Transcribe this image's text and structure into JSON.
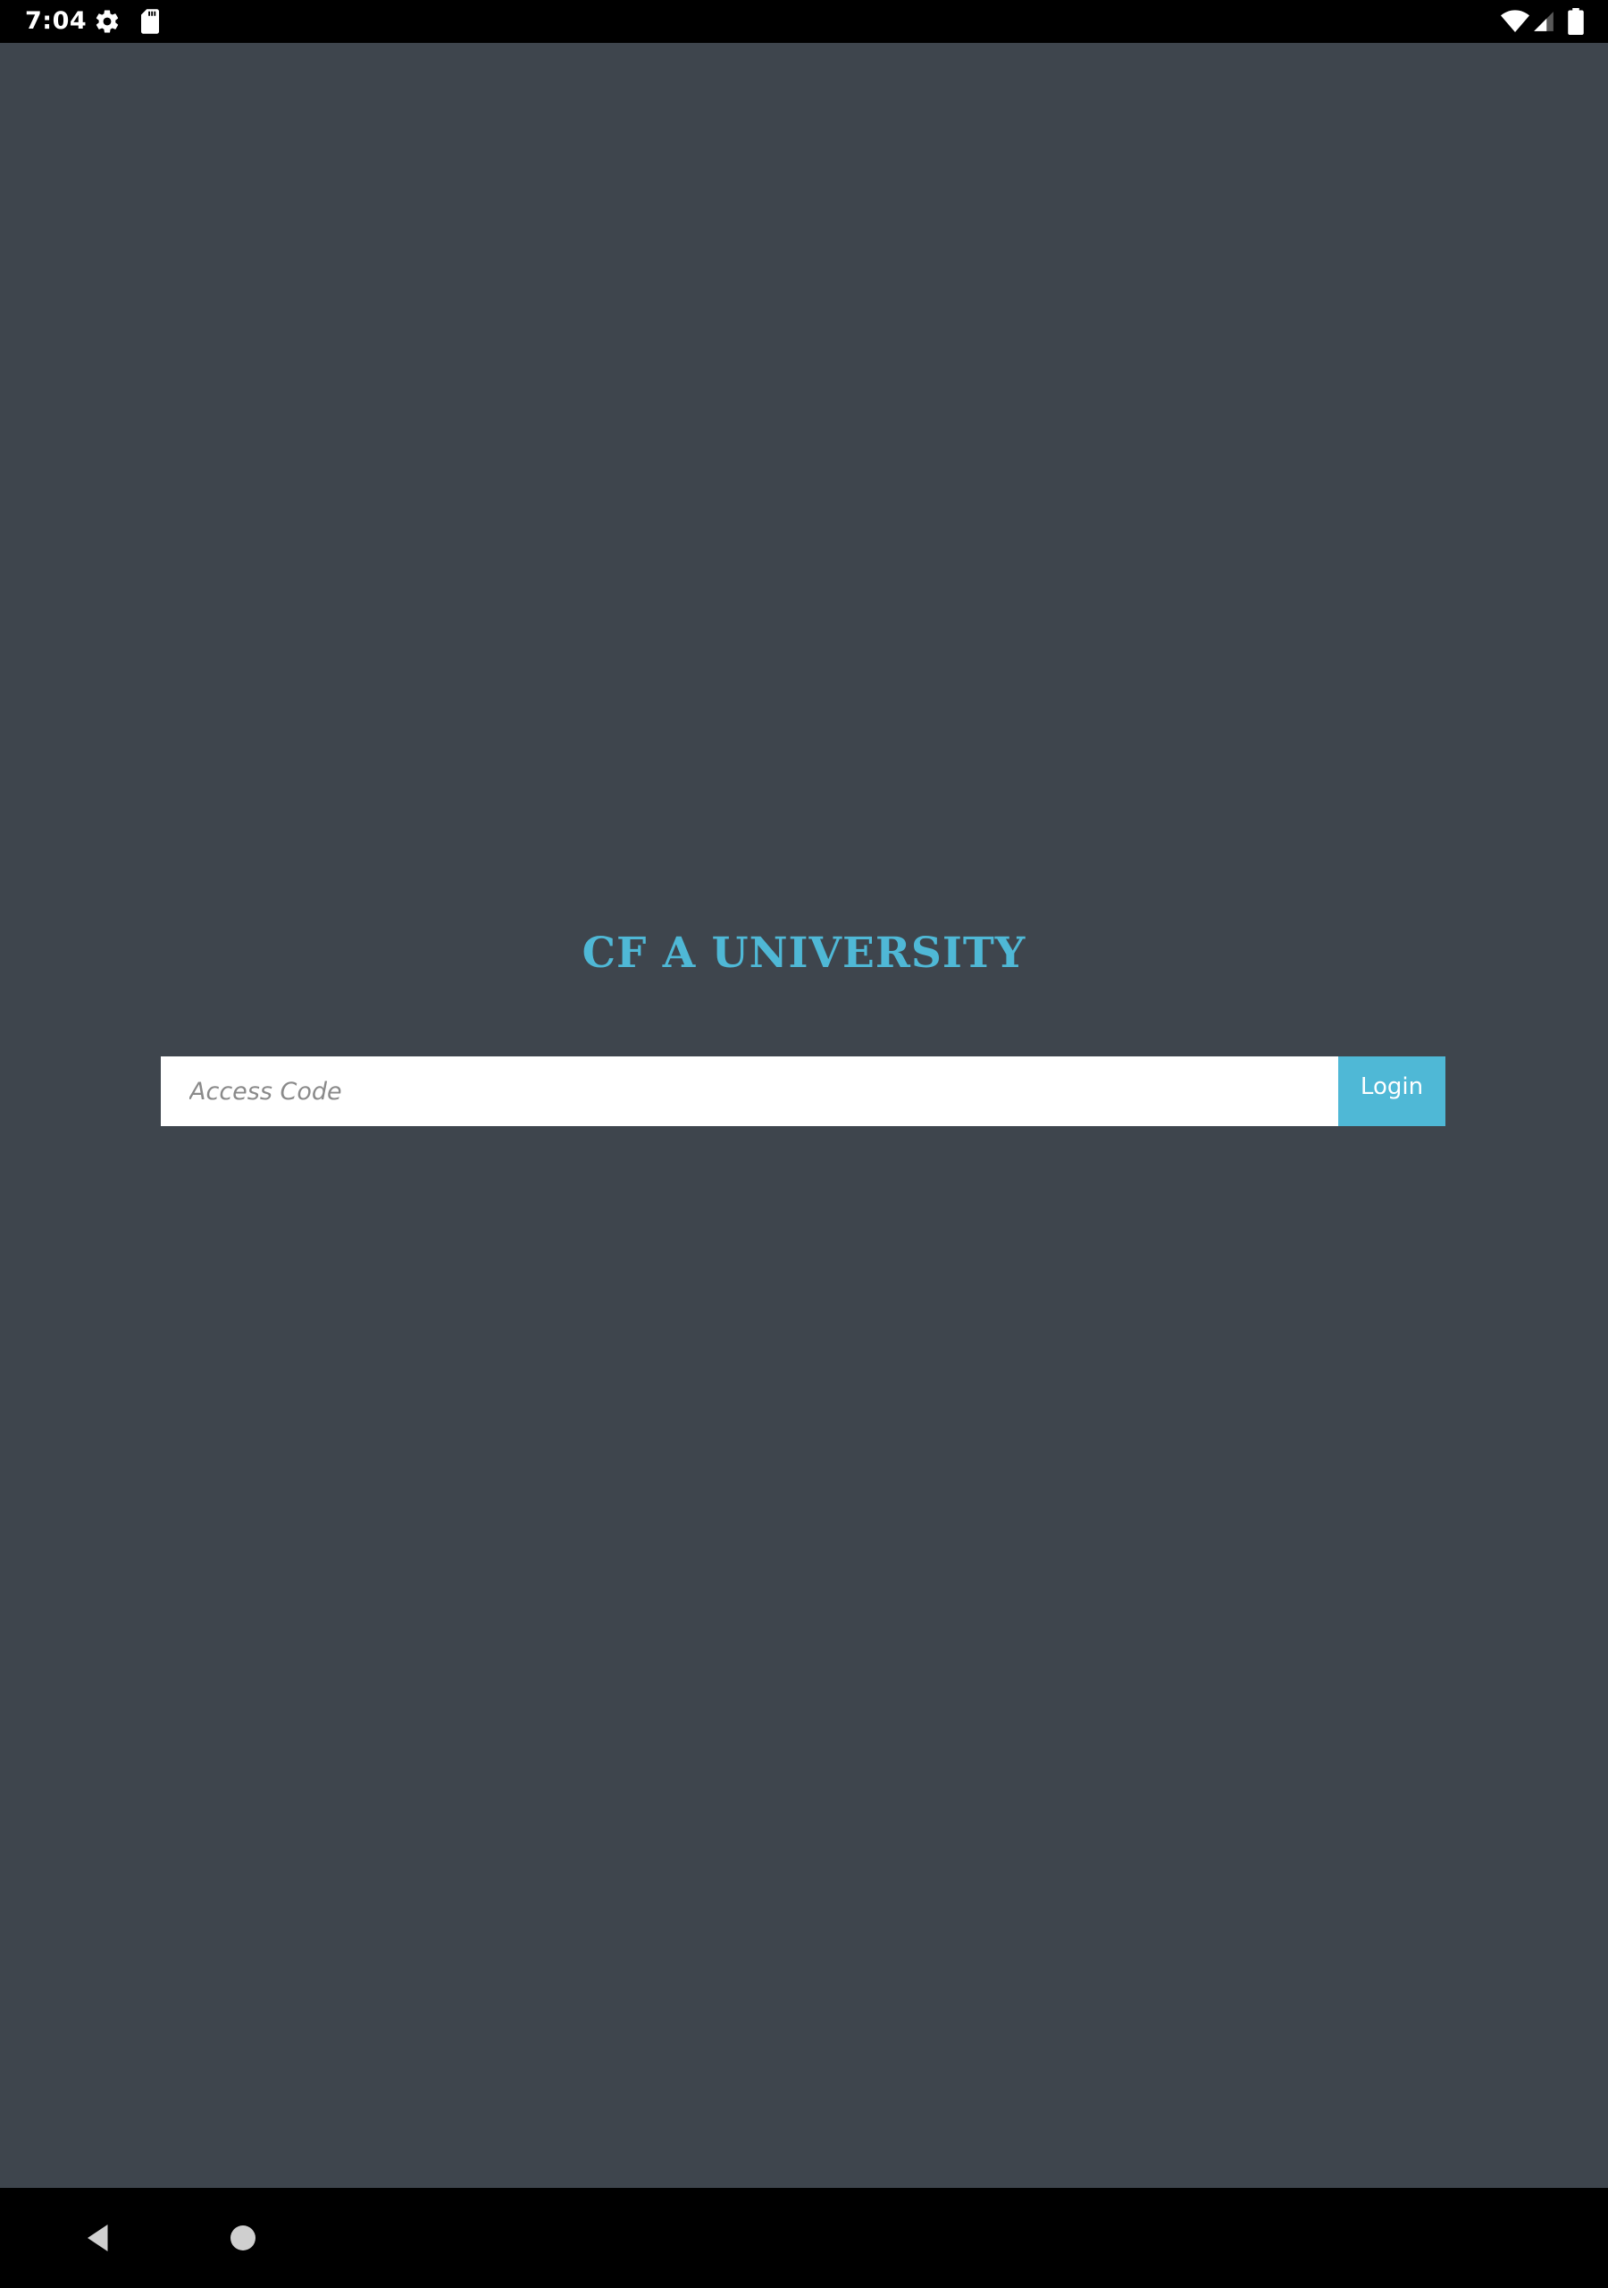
{
  "status_bar": {
    "time": "7:04",
    "icons_left": [
      "gear-icon",
      "sd-card-icon"
    ],
    "icons_right": [
      "wifi-icon",
      "cell-signal-icon",
      "battery-icon"
    ]
  },
  "app": {
    "title": "CF A UNIVERSITY",
    "access_code": {
      "value": "",
      "placeholder": "Access Code"
    },
    "login_label": "Login"
  },
  "nav_bar": {
    "icons": [
      "back-icon",
      "home-icon"
    ]
  },
  "colors": {
    "background": "#3e454d",
    "accent": "#4fb8d6",
    "system_bars": "#000000",
    "input_background": "#ffffff"
  }
}
